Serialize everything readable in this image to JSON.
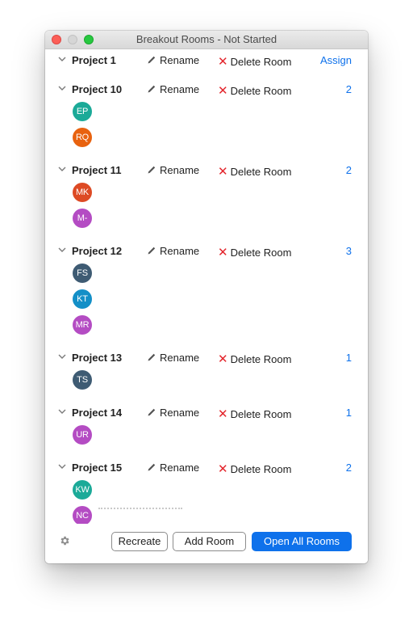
{
  "window": {
    "title": "Breakout Rooms - Not Started"
  },
  "actions": {
    "rename_label": "Rename",
    "delete_label": "Delete Room",
    "delete_glyph": "✕"
  },
  "rooms": [
    {
      "name": "Project 1",
      "count": "Assign",
      "participants": []
    },
    {
      "name": "Project 10",
      "count": "2",
      "participants": [
        {
          "initials": "EP",
          "color": "#1baa98"
        },
        {
          "initials": "RQ",
          "color": "#e8620f"
        }
      ]
    },
    {
      "name": "Project 11",
      "count": "2",
      "participants": [
        {
          "initials": "MK",
          "color": "#dd4a24"
        },
        {
          "initials": "M-",
          "color": "#b44cc3"
        }
      ]
    },
    {
      "name": "Project 12",
      "count": "3",
      "participants": [
        {
          "initials": "FS",
          "color": "#3e5b73"
        },
        {
          "initials": "KT",
          "color": "#138fc7"
        },
        {
          "initials": "MR",
          "color": "#b44cc3"
        }
      ]
    },
    {
      "name": "Project 13",
      "count": "1",
      "participants": [
        {
          "initials": "TS",
          "color": "#3e5b73"
        }
      ]
    },
    {
      "name": "Project 14",
      "count": "1",
      "participants": [
        {
          "initials": "UR",
          "color": "#b44cc3"
        }
      ]
    },
    {
      "name": "Project 15",
      "count": "2",
      "participants": [
        {
          "initials": "KW",
          "color": "#1baa98"
        },
        {
          "initials": "NC",
          "color": "#b44cc3"
        }
      ]
    }
  ],
  "footer": {
    "recreate_label": "Recreate",
    "add_room_label": "Add Room",
    "open_all_label": "Open All Rooms"
  },
  "colors": {
    "accent": "#0e71eb",
    "delete_x": "#e3242b"
  },
  "icons": {
    "room_toggle": "chevron-down-icon",
    "rename": "pencil-icon",
    "delete": "close-icon",
    "settings": "gear-icon"
  }
}
